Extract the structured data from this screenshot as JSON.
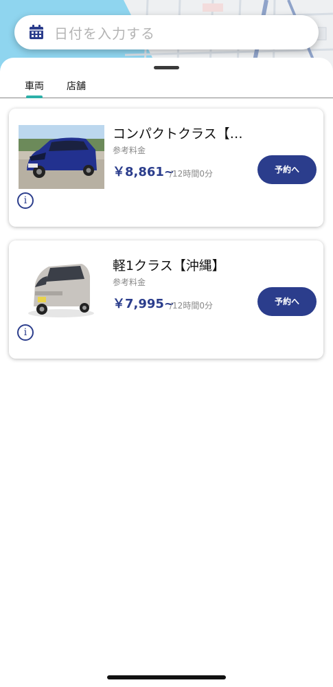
{
  "search": {
    "placeholder": "日付を入力する",
    "icon": "calendar-icon"
  },
  "tabs": [
    {
      "label": "車両",
      "active": true
    },
    {
      "label": "店舗",
      "active": false
    }
  ],
  "vehicles": [
    {
      "name": "コンパクトクラス【…",
      "ref_label": "参考料金",
      "price": "￥8,861~",
      "unit": "/12時間0分",
      "button": "予約へ",
      "car_color": "#22318f"
    },
    {
      "name": "軽1クラス【沖縄】",
      "ref_label": "参考料金",
      "price": "￥7,995~",
      "unit": "/12時間0分",
      "button": "予約へ",
      "car_color": "#c8c4bf"
    }
  ],
  "colors": {
    "accent": "#2b3d8c",
    "tab_indicator": "#2cb0a8",
    "map_water": "#8fd5ef"
  }
}
